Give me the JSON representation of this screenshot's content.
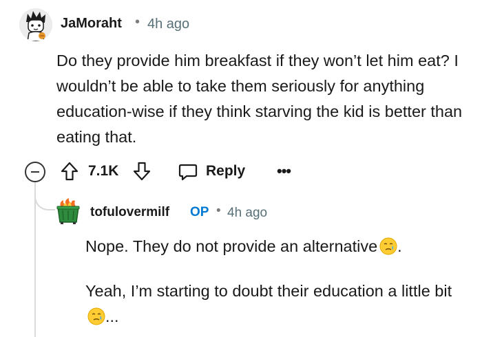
{
  "parent_comment": {
    "author": "JaMoraht",
    "separator": "•",
    "time": "4h ago",
    "body": "Do they provide him breakfast if they won’t let him eat? I wouldn’t be able to take them seriously for anything education-wise if they think starving the kid is better than eating that."
  },
  "actions": {
    "score": "7.1K",
    "reply_label": "Reply",
    "more_label": "•••"
  },
  "reply_comment": {
    "author": "tofulovermilf",
    "op_badge": "OP",
    "separator": "•",
    "time": "4h ago",
    "line1_text": "Nope. They do not provide an alternative",
    "line1_after": ".",
    "line2_text": "Yeah, I’m starting to doubt their education a little bit",
    "line2_after": "...",
    "emoji_name": "crying-face-emoji"
  },
  "colors": {
    "op_blue": "#0079d3",
    "meta_gray": "#576f76",
    "thread_gray": "#d9d9d9",
    "avatar_green": "#2e8b3d"
  }
}
